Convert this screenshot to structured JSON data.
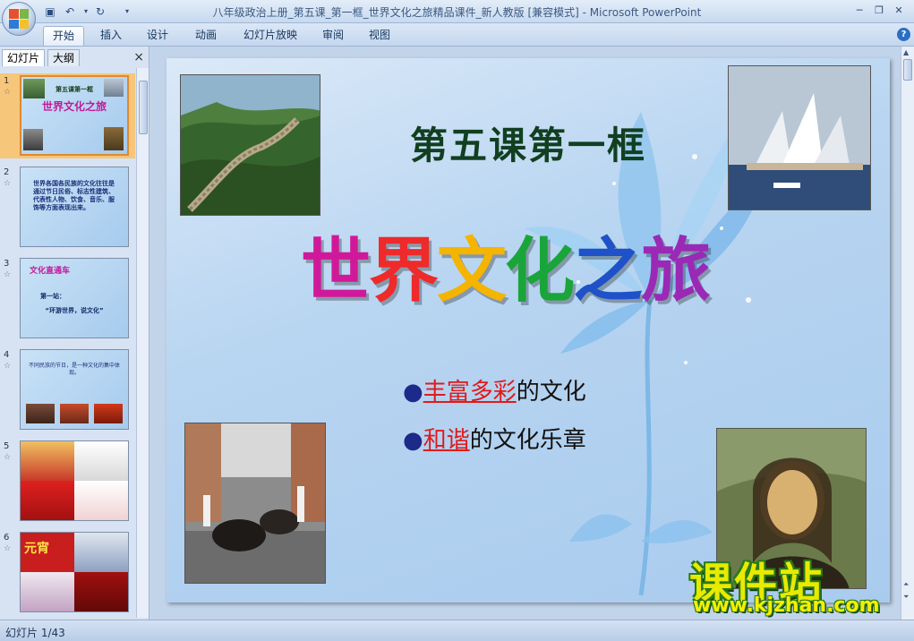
{
  "window": {
    "title": "八年级政治上册_第五课_第一框_世界文化之旅精品课件_新人教版 [兼容模式] - Microsoft PowerPoint"
  },
  "ribbon": {
    "tabs": [
      {
        "label": "开始",
        "active": true
      },
      {
        "label": "插入",
        "active": false
      },
      {
        "label": "设计",
        "active": false
      },
      {
        "label": "动画",
        "active": false
      },
      {
        "label": "幻灯片放映",
        "active": false
      },
      {
        "label": "审阅",
        "active": false
      },
      {
        "label": "视图",
        "active": false
      }
    ],
    "help_glyph": "?"
  },
  "panel": {
    "tabs": [
      "幻灯片",
      "大纲"
    ],
    "close_glyph": "×",
    "slides": [
      {
        "number": "1",
        "lines": [
          "第五课第一框",
          "世界文化之旅"
        ]
      },
      {
        "number": "2",
        "lines": [
          "世界各国各民族的文化往往是通过节日民俗、标志性建筑、代表性人物、饮食、音乐、服饰等方面表现出来。"
        ]
      },
      {
        "number": "3",
        "lines": [
          "文化直通车",
          "第一站：",
          "“环游世界，说文化”"
        ]
      },
      {
        "number": "4",
        "lines": [
          "不同民族的节日，是一种文化的集中体现。"
        ]
      },
      {
        "number": "5",
        "lines": []
      },
      {
        "number": "6",
        "lines": [
          "元宵"
        ]
      }
    ]
  },
  "slide": {
    "lesson_title": "第五课第一框",
    "main_title_chars": [
      "世",
      "界",
      "文",
      "化",
      "之",
      "旅"
    ],
    "main_title_colors": [
      "#d0199a",
      "#ee2a2a",
      "#f4b400",
      "#1aa53a",
      "#1f52c8",
      "#9a29b6"
    ],
    "bullets": [
      {
        "dot": "●",
        "em": "丰富多彩",
        "rest": "的文化"
      },
      {
        "dot": "●",
        "em": "和谐",
        "rest": "的文化乐章"
      }
    ]
  },
  "watermark": {
    "title": "课件站",
    "url": "www.kjzhan.com"
  },
  "status": {
    "slide_counter": "幻灯片 1/43"
  }
}
